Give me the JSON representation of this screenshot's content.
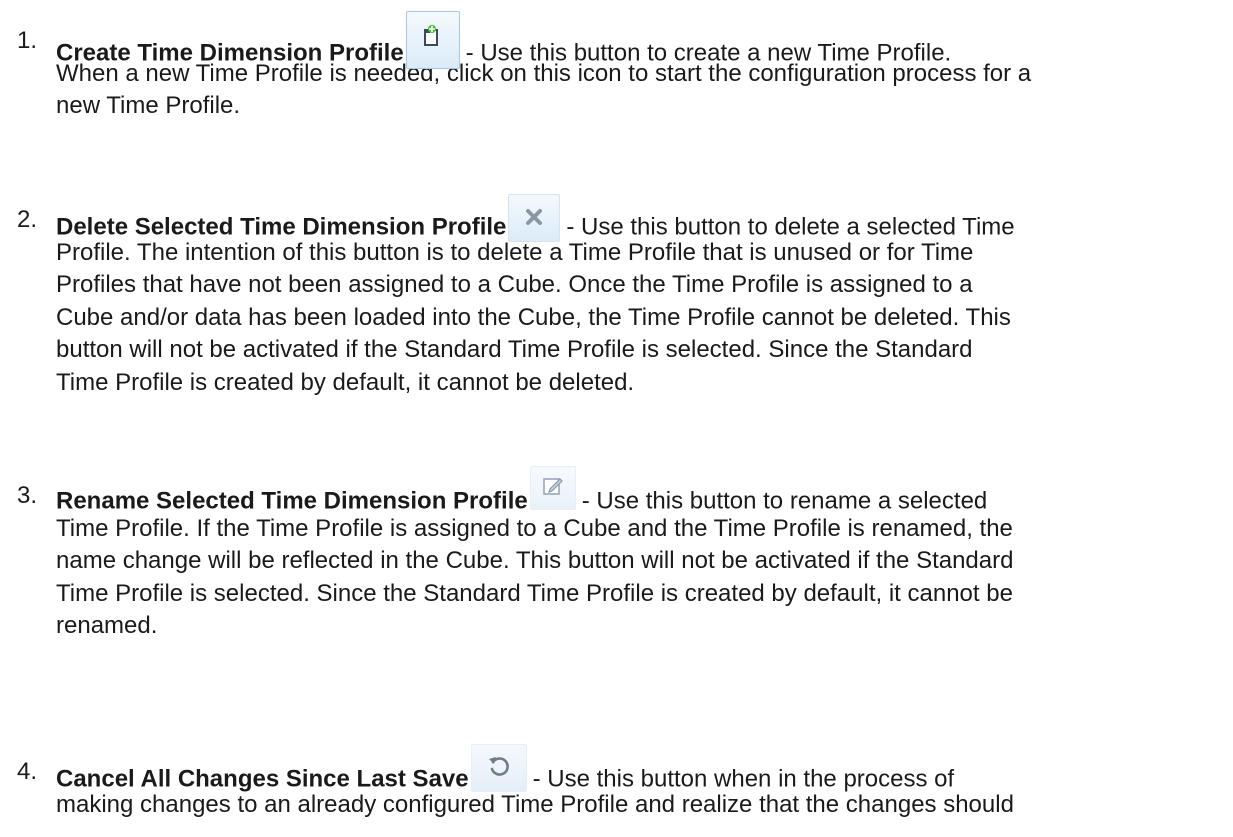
{
  "items": [
    {
      "number": "1.",
      "title": "Create Time Dimension Profile",
      "icon": "create-profile-icon",
      "lines": [
        "- Use this button to create a new Time Profile.",
        "When a new Time Profile is needed, click on this icon to start the configuration process for a",
        "new Time Profile."
      ]
    },
    {
      "number": "2.",
      "title": "Delete Selected Time Dimension Profile",
      "icon": "delete-icon",
      "lines": [
        "- Use this button to delete a selected Time",
        "Profile. The intention of this button is to delete a Time Profile that is unused or for Time",
        "Profiles that have not been assigned to a Cube. Once the Time Profile is assigned to a",
        "Cube and/or data has been loaded into the Cube, the Time Profile cannot be deleted. This",
        "button will not be activated if the Standard Time Profile is selected. Since the Standard",
        "Time Profile is created by default, it cannot be deleted."
      ]
    },
    {
      "number": "3.",
      "title": "Rename Selected Time Dimension Profile",
      "icon": "rename-icon",
      "lines": [
        "- Use this button to rename a selected",
        "Time Profile. If the Time Profile is assigned to a Cube and the Time Profile is renamed, the",
        "name change will be reflected in the Cube. This button will not be activated if the Standard",
        "Time Profile is selected. Since the Standard Time Profile is created by default, it cannot be",
        "renamed."
      ]
    },
    {
      "number": "4.",
      "title": "Cancel All Changes Since Last Save",
      "icon": "undo-icon",
      "lines": [
        "- Use this button when in the process of",
        "making changes to an already configured Time Profile and realize that the changes should"
      ]
    }
  ]
}
